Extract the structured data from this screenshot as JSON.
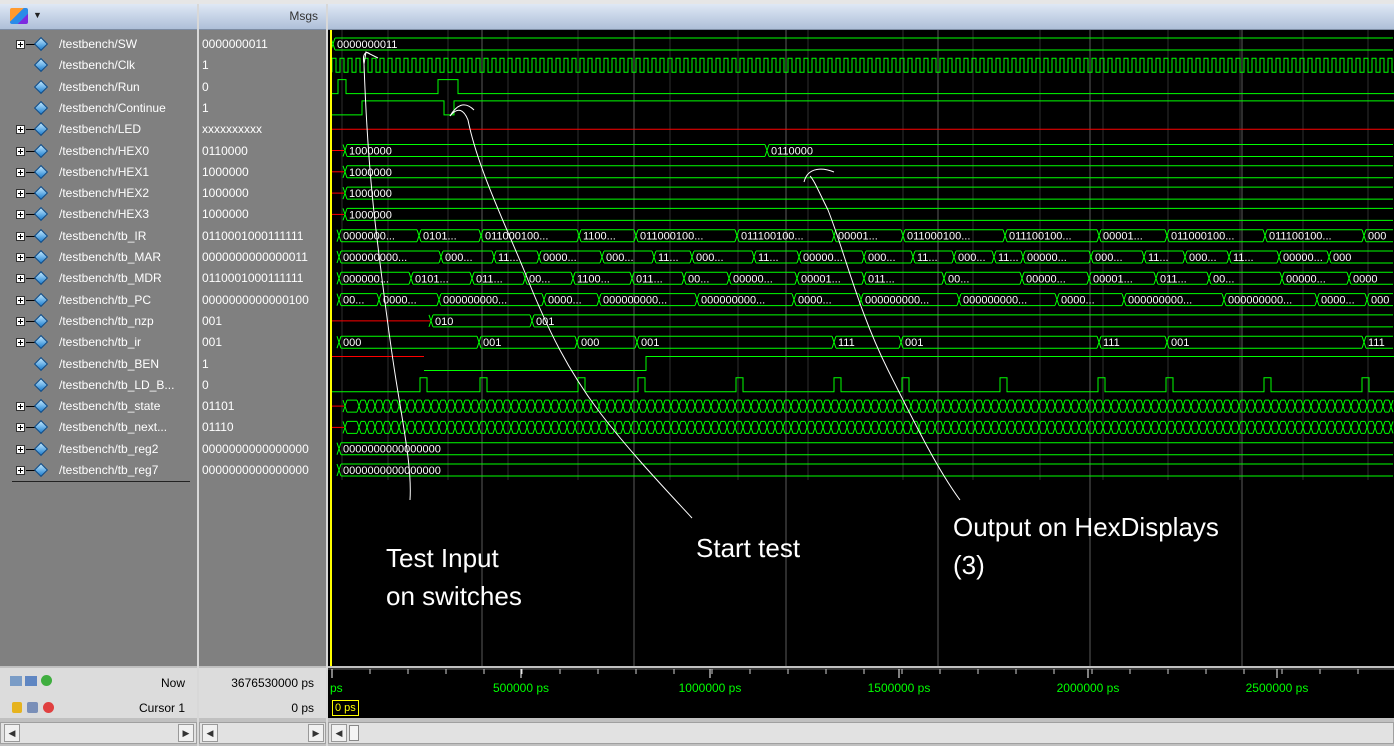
{
  "header": {
    "msgs_label": "Msgs"
  },
  "signals": [
    {
      "name": "/testbench/SW",
      "value": "0000000011",
      "expandable": true
    },
    {
      "name": "/testbench/Clk",
      "value": "1",
      "expandable": false
    },
    {
      "name": "/testbench/Run",
      "value": "0",
      "expandable": false
    },
    {
      "name": "/testbench/Continue",
      "value": "1",
      "expandable": false
    },
    {
      "name": "/testbench/LED",
      "value": "xxxxxxxxxx",
      "expandable": true
    },
    {
      "name": "/testbench/HEX0",
      "value": "0110000",
      "expandable": true
    },
    {
      "name": "/testbench/HEX1",
      "value": "1000000",
      "expandable": true
    },
    {
      "name": "/testbench/HEX2",
      "value": "1000000",
      "expandable": true
    },
    {
      "name": "/testbench/HEX3",
      "value": "1000000",
      "expandable": true
    },
    {
      "name": "/testbench/tb_IR",
      "value": "0110001000111111",
      "expandable": true
    },
    {
      "name": "/testbench/tb_MAR",
      "value": "0000000000000011",
      "expandable": true
    },
    {
      "name": "/testbench/tb_MDR",
      "value": "0110001000111111",
      "expandable": true
    },
    {
      "name": "/testbench/tb_PC",
      "value": "0000000000000100",
      "expandable": true
    },
    {
      "name": "/testbench/tb_nzp",
      "value": "001",
      "expandable": true
    },
    {
      "name": "/testbench/tb_ir",
      "value": "001",
      "expandable": true
    },
    {
      "name": "/testbench/tb_BEN",
      "value": "1",
      "expandable": false
    },
    {
      "name": "/testbench/tb_LD_B...",
      "value": "0",
      "expandable": false
    },
    {
      "name": "/testbench/tb_state",
      "value": "01101",
      "expandable": true
    },
    {
      "name": "/testbench/tb_next...",
      "value": "01110",
      "expandable": true
    },
    {
      "name": "/testbench/tb_reg2",
      "value": "0000000000000000",
      "expandable": true
    },
    {
      "name": "/testbench/tb_reg7",
      "value": "0000000000000000",
      "expandable": true
    }
  ],
  "wave_labels": {
    "sw": [
      "0000000011"
    ],
    "hex0": [
      "1000000",
      "0110000"
    ],
    "hex1": [
      "1000000"
    ],
    "hex2": [
      "1000000"
    ],
    "hex3": [
      "1000000"
    ],
    "tb_IR": [
      "0000000...",
      "0101...",
      "011000100...",
      "1100...",
      "011000100...",
      "011100100...",
      "00001...",
      "011000100...",
      "011100100...",
      "00001...",
      "011000100...",
      "011100100...",
      "000"
    ],
    "tb_MAR": [
      "000000000...",
      "000...",
      "11...",
      "0000...",
      "000...",
      "11...",
      "000...",
      "11...",
      "00000...",
      "000...",
      "11...",
      "000...",
      "11...",
      "00000...",
      "000...",
      "11...",
      "000...",
      "11...",
      "00000...",
      "000"
    ],
    "tb_MDR": [
      "000000...",
      "0101...",
      "011...",
      "00...",
      "1100...",
      "011...",
      "00...",
      "00000...",
      "00001...",
      "011...",
      "00...",
      "00000...",
      "00001...",
      "011...",
      "00...",
      "00000...",
      "0000"
    ],
    "tb_PC": [
      "00...",
      "0000...",
      "000000000...",
      "0000...",
      "000000000...",
      "000000000...",
      "0000...",
      "000000000...",
      "000000000...",
      "0000...",
      "000000000...",
      "000000000...",
      "0000...",
      "000"
    ],
    "tb_nzp": [
      "010",
      "001"
    ],
    "tb_ir": [
      "000",
      "001",
      "000",
      "001",
      "111",
      "001",
      "111",
      "001",
      "111"
    ],
    "tb_reg2": [
      "0000000000000000"
    ],
    "tb_reg7": [
      "0000000000000000"
    ]
  },
  "status": {
    "now_label": "Now",
    "now_value": "3676530000 ps",
    "cursor_label": "Cursor 1",
    "cursor_value": "0 ps",
    "cursor_tag": "0 ps"
  },
  "timeline": {
    "ticks": [
      "ps",
      "500000 ps",
      "1000000 ps",
      "1500000 ps",
      "2000000 ps",
      "2500000 ps"
    ]
  },
  "annotations": {
    "test_input": "Test Input",
    "test_input_2": "on switches",
    "start_test": "Start test",
    "output_hex": "Output on HexDisplays",
    "output_hex_2": "(3)"
  },
  "colors": {
    "wave": "#00ff00",
    "undefined": "#ff0000",
    "grid": "#5a5a5a",
    "cursor": "#ffff00",
    "timeline_text": "#00ff00"
  }
}
